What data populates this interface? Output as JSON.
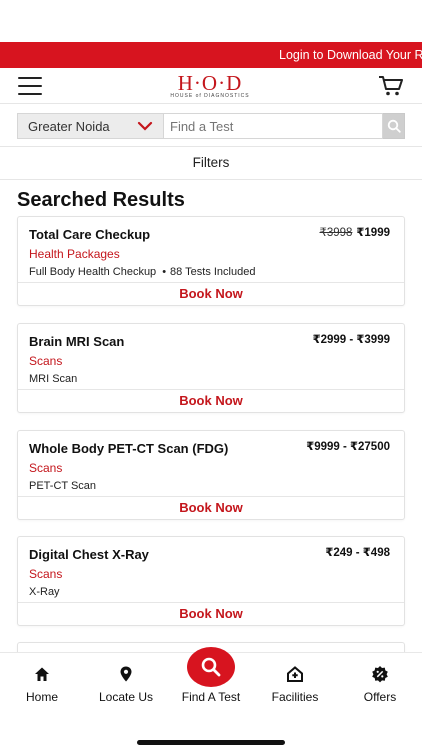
{
  "promo": {
    "text": "Login to Download Your R"
  },
  "header": {
    "logo_main": "H·O·D",
    "logo_sub": "HOUSE of DIAGNOSTICS",
    "menu_icon": "hamburger-menu-icon",
    "cart_icon": "cart-icon"
  },
  "search": {
    "city": "Greater Noida",
    "placeholder": "Find a Test",
    "search_icon": "search-icon"
  },
  "filters": {
    "label": "Filters"
  },
  "results": {
    "title": "Searched Results",
    "book_label": "Book Now",
    "items": [
      {
        "name": "Total Care Checkup",
        "old_price": "₹3998",
        "price": "₹1999",
        "category": "Health Packages",
        "subtitle": "Full Body Health Checkup",
        "tests": "88 Tests Included"
      },
      {
        "name": "Brain MRI Scan",
        "price": "₹2999 - ₹3999",
        "category": "Scans",
        "subtitle": "MRI Scan"
      },
      {
        "name": "Whole Body PET-CT Scan (FDG)",
        "price": "₹9999 - ₹27500",
        "category": "Scans",
        "subtitle": "PET-CT Scan"
      },
      {
        "name": "Digital Chest X-Ray",
        "price": "₹249 - ₹498",
        "category": "Scans",
        "subtitle": "X-Ray"
      }
    ]
  },
  "bottom_nav": {
    "items": [
      {
        "label": "Home",
        "icon": "home-icon"
      },
      {
        "label": "Locate Us",
        "icon": "location-pin-icon"
      },
      {
        "label": "Find A Test",
        "icon": "search-icon"
      },
      {
        "label": "Facilities",
        "icon": "facilities-icon"
      },
      {
        "label": "Offers",
        "icon": "offer-badge-icon"
      }
    ]
  },
  "colors": {
    "brand_red": "#d7141f",
    "accent_red": "#c4161c"
  }
}
